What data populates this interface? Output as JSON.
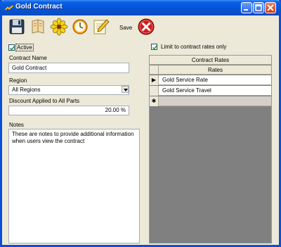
{
  "window": {
    "title": "Gold Contract"
  },
  "toolbar": {
    "save_label": "Save"
  },
  "form": {
    "active_label": "Active",
    "active_checked": true,
    "contract_name_label": "Contract Name",
    "contract_name_value": "Gold Contract",
    "region_label": "Region",
    "region_value": "All Regions",
    "discount_label": "Discount Applied to All Parts",
    "discount_value": "20.00 %",
    "notes_label": "Notes",
    "notes_value": "These are notes to provide additional information when users view the contract"
  },
  "rates": {
    "limit_label": "Limit to contract rates only",
    "limit_checked": true,
    "caption": "Contract Rates",
    "column_header": "Rates",
    "rows": [
      {
        "value": "Gold Service Rate",
        "marker": "▶"
      },
      {
        "value": "Gold Service Travel",
        "marker": ""
      }
    ],
    "new_row_marker": "✱"
  },
  "colors": {
    "titlebar": "#0553d4",
    "window_bg": "#ece9d8",
    "close_button": "#d03a10"
  },
  "icons": [
    "app-icon",
    "save-icon",
    "book-icon",
    "flower-icon",
    "clock-icon",
    "edit-pencil-icon",
    "delete-icon",
    "minimize-icon",
    "maximize-icon",
    "close-icon"
  ]
}
